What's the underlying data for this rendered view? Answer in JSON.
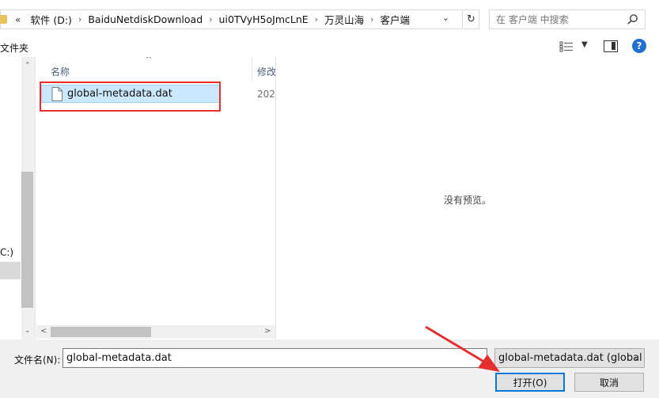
{
  "address": {
    "prefix": "«",
    "crumbs": [
      "软件 (D:)",
      "BaiduNetdiskDownload",
      "ui0TVyH5oJmcLnE",
      "万灵山海",
      "客户端"
    ],
    "separator": "›",
    "dropdown": "⌄",
    "refresh": "↻"
  },
  "search": {
    "placeholder": "在 客户端 中搜索"
  },
  "toolbar": {
    "new_folder": "文件夹",
    "view_dropdown": "▼",
    "help": "?"
  },
  "nav": {
    "drive_label": "C:)",
    "scroll_up": "⌃",
    "scroll_down": "⌄"
  },
  "columns": {
    "name": "名称",
    "modified": "修改"
  },
  "files": [
    {
      "name": "global-metadata.dat",
      "modified": "202"
    }
  ],
  "hscroll": {
    "left": "<",
    "right": ">"
  },
  "preview": {
    "message": "没有预览。"
  },
  "bottom": {
    "filename_label": "文件名(N):",
    "filename_value": "global-metadata.dat",
    "filetype_value": "global-metadata.dat (global",
    "filetype_caret": "⌄",
    "open_label": "打开(O)",
    "cancel_label": "取消"
  },
  "colors": {
    "selection": "#cce8ff",
    "annotation": "#e52f2f",
    "accent": "#0078d7"
  }
}
